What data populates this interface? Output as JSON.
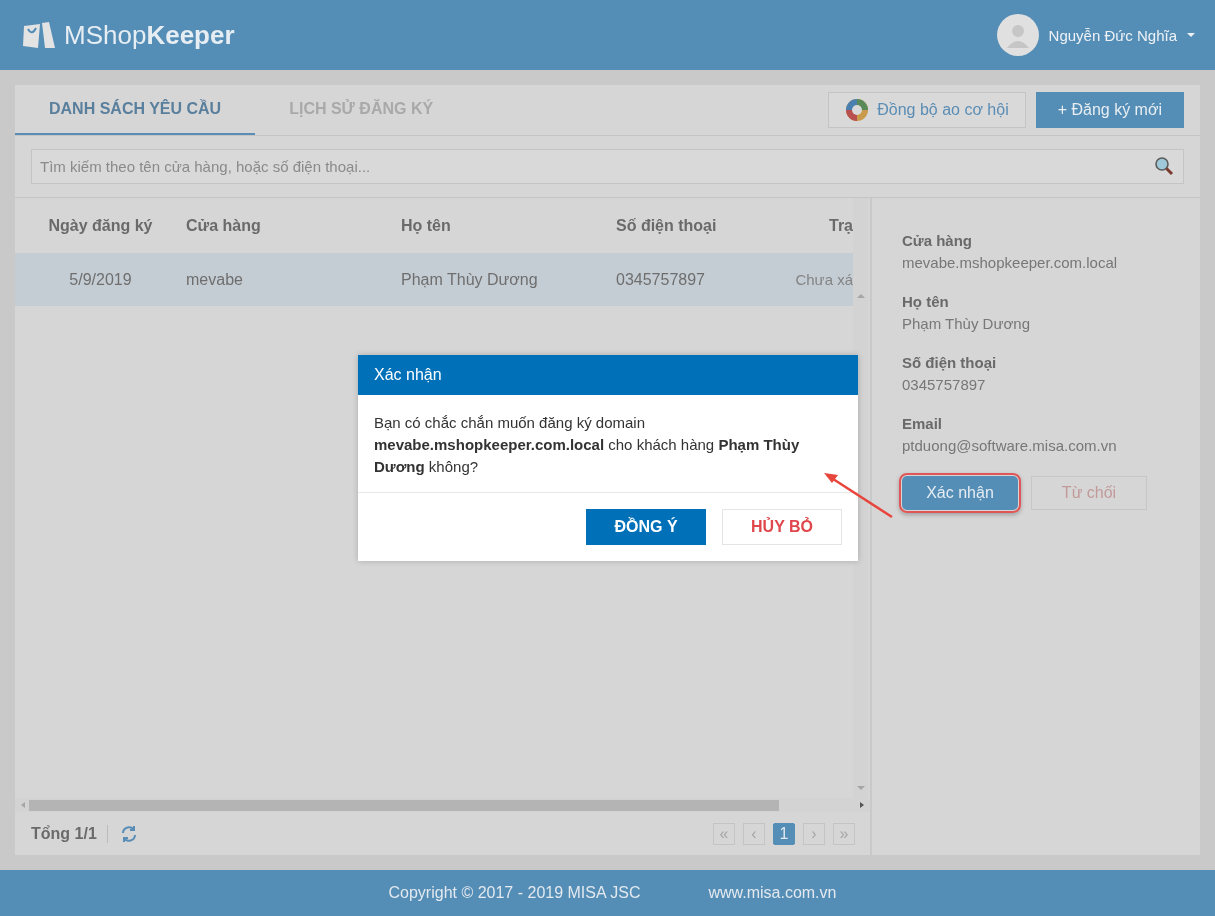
{
  "header": {
    "logo": "MShop**Keeper**",
    "user_name": "Nguyễn Đức Nghĩa"
  },
  "tabs": [
    {
      "label": "DANH SÁCH YÊU CẦU",
      "selected": true
    },
    {
      "label": "LỊCH SỬ ĐĂNG KÝ",
      "selected": false
    }
  ],
  "toolbar": {
    "sync_button": "Đồng bộ ao cơ hội",
    "new_button": "+ Đăng ký mới"
  },
  "search": {
    "placeholder": "Tìm kiếm theo tên cửa hàng, hoặc số điện thoại..."
  },
  "table": {
    "columns": [
      "Ngày đăng ký",
      "Cửa hàng",
      "Họ tên",
      "Số điện thoại",
      "Trạ"
    ],
    "rows": [
      {
        "cells": [
          "5/9/2019",
          "mevabe",
          "Phạm Thùy Dương",
          "0345757897",
          "Chưa xá"
        ],
        "selected": true
      }
    ]
  },
  "table_footer": {
    "total": "Tổng 1/1",
    "pagination": {
      "first": "«",
      "prev": "‹",
      "pages": [
        {
          "label": "1",
          "selected": true
        }
      ],
      "next": "›",
      "last": "»"
    }
  },
  "details": {
    "fields": [
      {
        "label": "Cửa hàng",
        "value": "mevabe.mshopkeeper.com.local"
      },
      {
        "label": "Họ tên",
        "value": "Phạm Thùy Dương"
      },
      {
        "label": "Số điện thoại",
        "value": "0345757897"
      },
      {
        "label": "Email",
        "value": "ptduong@software.misa.com.vn"
      }
    ],
    "confirm_button": "Xác nhận",
    "reject_button": "Từ chối"
  },
  "dialog": {
    "title": "Xác nhận",
    "message": "Bạn có chắc chắn muốn đăng ký domain **mevabe.mshopkeeper.com.local** cho khách hàng **Phạm Thùy Dương** không?",
    "ok_button": "ĐỒNG Ý",
    "cancel_button": "HỦY BỎ"
  },
  "footer": {
    "copyright": "Copyright © 2017 - 2019 MISA JSC",
    "website": "www.misa.com.vn"
  }
}
